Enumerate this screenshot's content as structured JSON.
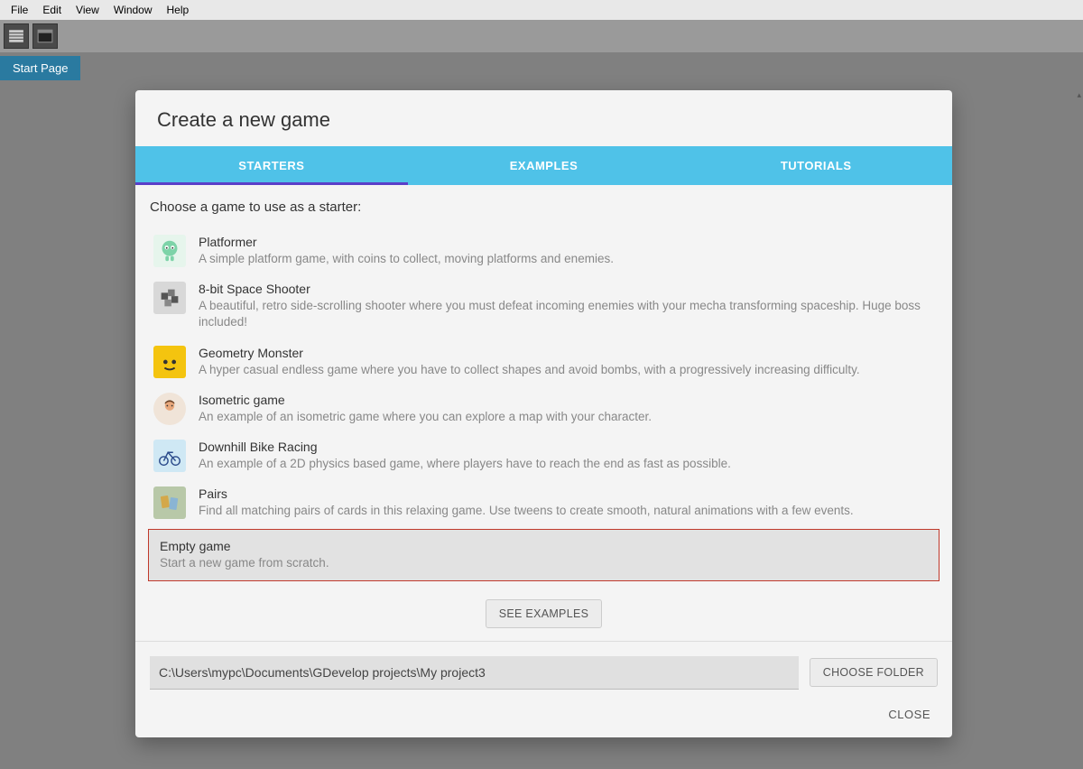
{
  "menubar": [
    "File",
    "Edit",
    "View",
    "Window",
    "Help"
  ],
  "tab": "Start Page",
  "dialog": {
    "title": "Create a new game",
    "tabs": [
      "STARTERS",
      "EXAMPLES",
      "TUTORIALS"
    ],
    "active_tab": 0,
    "subtitle": "Choose a game to use as a starter:",
    "starters": [
      {
        "title": "Platformer",
        "desc": "A simple platform game, with coins to collect, moving platforms and enemies."
      },
      {
        "title": "8-bit Space Shooter",
        "desc": "A beautiful, retro side-scrolling shooter where you must defeat incoming enemies with your mecha transforming spaceship. Huge boss included!"
      },
      {
        "title": "Geometry Monster",
        "desc": "A hyper casual endless game where you have to collect shapes and avoid bombs, with a progressively increasing difficulty."
      },
      {
        "title": "Isometric game",
        "desc": "An example of an isometric game where you can explore a map with your character."
      },
      {
        "title": "Downhill Bike Racing",
        "desc": "An example of a 2D physics based game, where players have to reach the end as fast as possible."
      },
      {
        "title": "Pairs",
        "desc": "Find all matching pairs of cards in this relaxing game. Use tweens to create smooth, natural animations with a few events."
      },
      {
        "title": "Empty game",
        "desc": "Start a new game from scratch.",
        "highlighted": true
      }
    ],
    "see_examples": "SEE EXAMPLES",
    "path": "C:\\Users\\mypc\\Documents\\GDevelop projects\\My project3",
    "choose_folder": "CHOOSE FOLDER",
    "close": "CLOSE"
  },
  "icons": {
    "platformer_bg": "#e6f5ec",
    "shooter_bg": "#d8d8d8",
    "geometry_bg": "#f4c40f",
    "iso_bg": "#f0e4d8",
    "bike_bg": "#cfe8f4",
    "pairs_bg": "#b8c8a8"
  }
}
